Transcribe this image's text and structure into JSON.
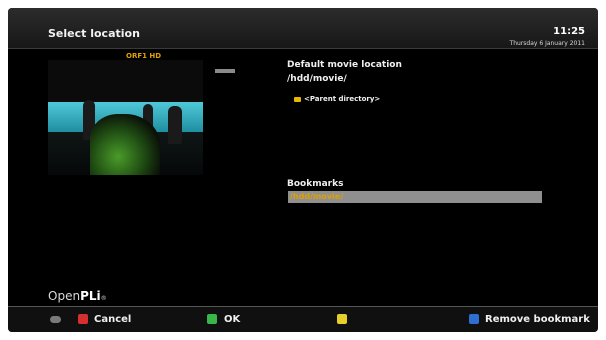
{
  "header": {
    "title": "Select location",
    "time": "11:25",
    "date": "Thursday 6 January 2011"
  },
  "preview": {
    "channel": "ORF1 HD"
  },
  "location": {
    "heading": "Default movie location",
    "path": "/hdd/movie/",
    "parent_item": "<Parent directory>"
  },
  "bookmarks": {
    "heading": "Bookmarks",
    "items": [
      "/hdd/movie/"
    ],
    "selected_index": 0
  },
  "brand": {
    "name_light": "Open",
    "name_bold": "PLi",
    "mark": "®"
  },
  "footer": {
    "buttons": [
      {
        "color": "#d43030",
        "label": "Cancel"
      },
      {
        "color": "#39b54a",
        "label": "OK"
      },
      {
        "color": "#e6cf2a",
        "label": ""
      },
      {
        "color": "#2f6fd1",
        "label": "Remove bookmark"
      }
    ]
  }
}
